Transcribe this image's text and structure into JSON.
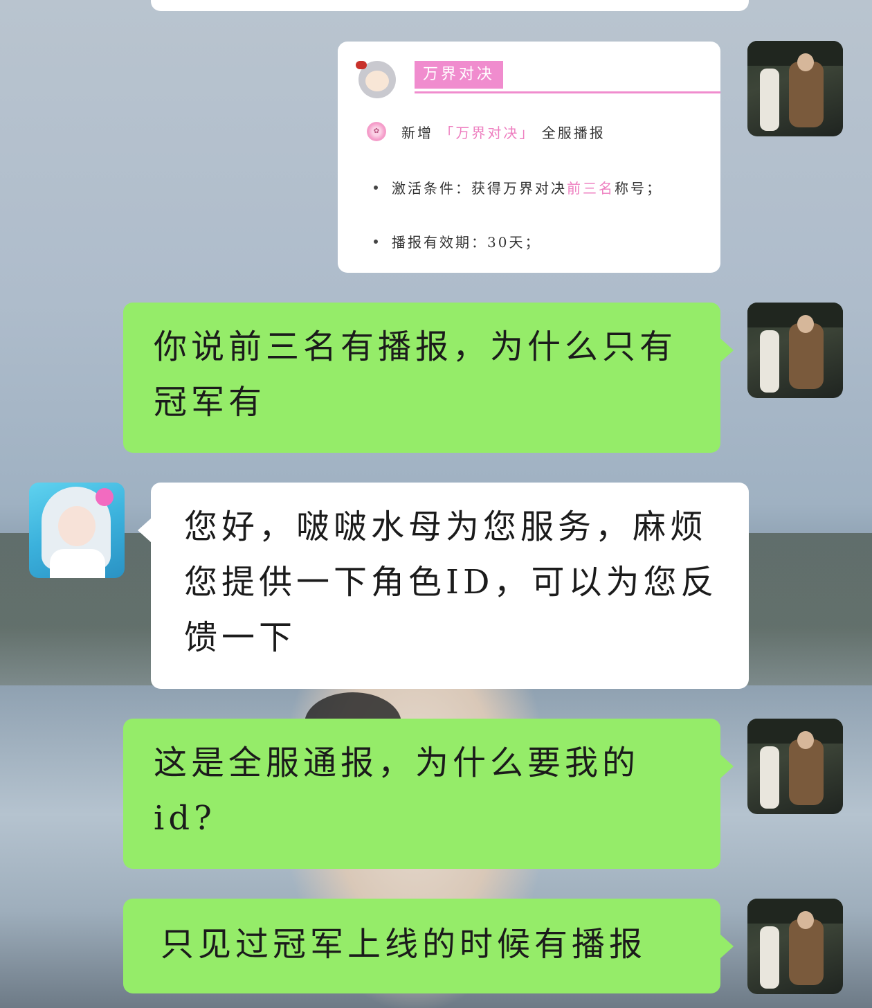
{
  "card": {
    "title": "万界对决",
    "new_line_prefix": "新增",
    "new_line_highlight": "「万界对决」",
    "new_line_suffix": "全服播报",
    "cond_label": "激活条件：获得万界对决",
    "cond_highlight": "前三名",
    "cond_suffix": "称号；",
    "validity": "播报有效期：30天；"
  },
  "messages": [
    {
      "side": "me",
      "text": "你说前三名有播报，为什么只有冠军有"
    },
    {
      "side": "bot",
      "text": "您好，啵啵水母为您服务，麻烦您提供一下角色ID，可以为您反馈一下"
    },
    {
      "side": "me",
      "text": "这是全服通报，为什么要我的id?"
    },
    {
      "side": "me",
      "text": "只见过冠军上线的时候有播报"
    }
  ],
  "colors": {
    "outgoing_bubble": "#95ec69",
    "incoming_bubble": "#ffffff",
    "card_accent": "#f08cce"
  },
  "icons": {
    "me_avatar": "user-avatar",
    "bot_avatar": "assistant-avatar",
    "card_mascot": "mascot-icon",
    "card_flower": "sakura-icon"
  }
}
